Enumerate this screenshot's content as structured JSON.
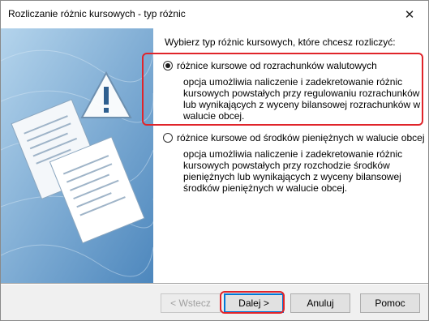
{
  "window": {
    "title": "Rozliczanie różnic kursowych - typ różnic",
    "close_glyph": "✕"
  },
  "main": {
    "prompt": "Wybierz typ różnic kursowych, które chcesz rozliczyć:",
    "options": [
      {
        "label": "różnice kursowe od rozrachunków walutowych",
        "selected": true,
        "description": [
          "opcja umożliwia naliczenie i zadekretowanie różnic",
          "kursowych powstałych przy regulowaniu rozrachunków",
          "lub wynikających z wyceny bilansowej rozrachunków w",
          "walucie obcej."
        ]
      },
      {
        "label": "różnice kursowe od środków pieniężnych w walucie obcej",
        "selected": false,
        "description": [
          "opcja umożliwia naliczenie i zadekretowanie różnic",
          "kursowych powstałych przy rozchodzie środków",
          "pieniężnych lub wynikających z wyceny bilansowej",
          "środków pieniężnych w walucie obcej."
        ]
      }
    ]
  },
  "buttons": {
    "back": "< Wstecz",
    "next": "Dalej >",
    "cancel": "Anuluj",
    "help": "Pomoc"
  },
  "colors": {
    "highlight": "#e0242a",
    "panel_blue": "#7fb0d8"
  },
  "icons": {
    "illustration": "documents-warning-icon",
    "close": "close-icon"
  }
}
